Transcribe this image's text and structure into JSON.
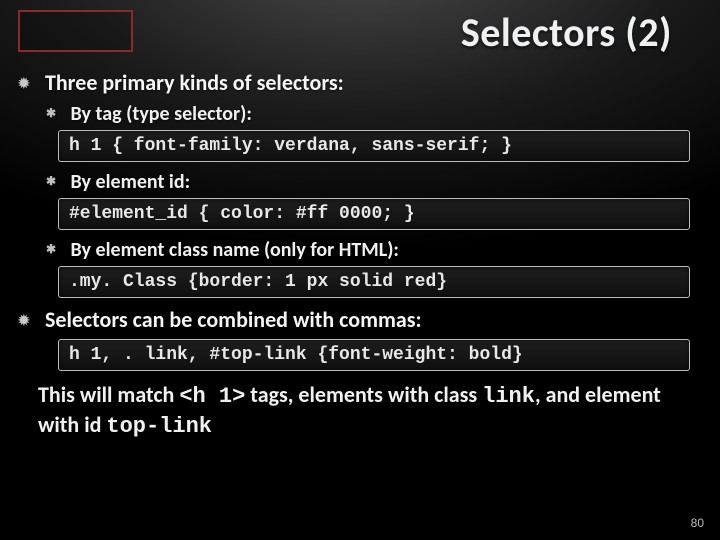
{
  "title": "Selectors (2)",
  "bullets": {
    "b1": "Three primary kinds of selectors:",
    "b1a": "By tag (type selector):",
    "code1": "h 1 { font-family: verdana, sans-serif; }",
    "b1b": "By element id:",
    "code2": "#element_id { color: #ff 0000; }",
    "b1c": "By element class name (only for HTML):",
    "code3": ".my. Class {border: 1 px solid red}",
    "b2": "Selectors can be combined with commas:",
    "code4": "h 1, . link, #top-link {font-weight: bold}"
  },
  "para": {
    "t1": "This will match ",
    "m1": "<h 1>",
    "t2": " tags, elements with class ",
    "m2": "link",
    "t3": ", and element with id ",
    "m3": "top-link"
  },
  "pagenum": "80"
}
